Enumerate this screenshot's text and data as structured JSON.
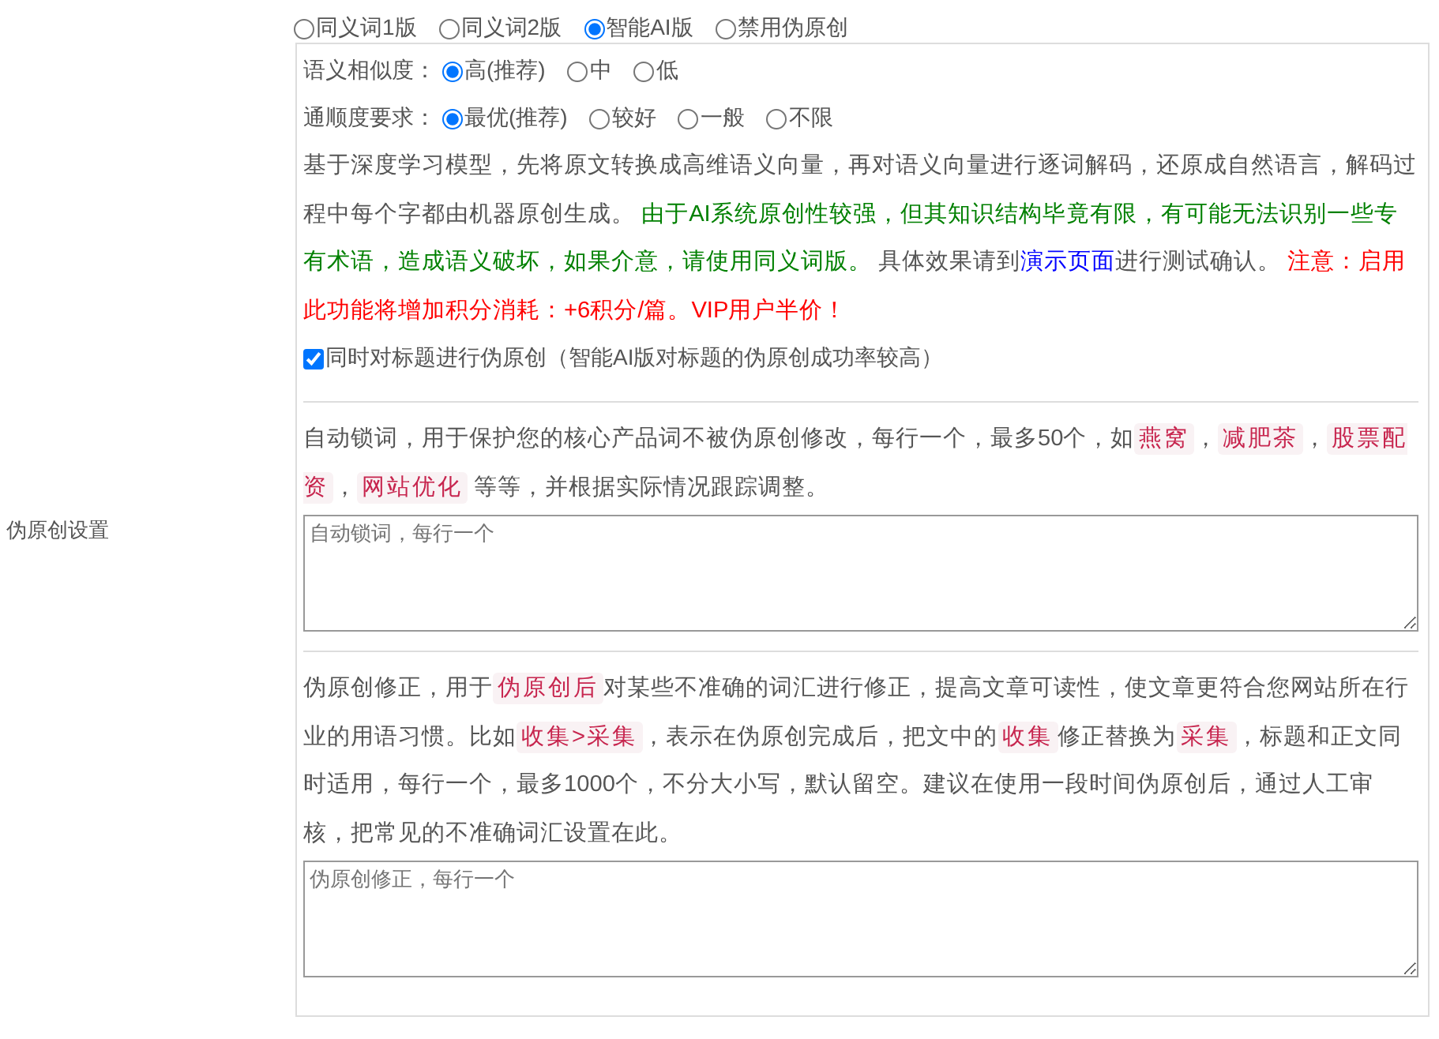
{
  "section_label": "伪原创设置",
  "modes": [
    {
      "label": "同义词1版",
      "selected": false
    },
    {
      "label": "同义词2版",
      "selected": false
    },
    {
      "label": "智能AI版",
      "selected": true
    },
    {
      "label": "禁用伪原创",
      "selected": false
    }
  ],
  "settings": [
    {
      "label": "语义相似度：",
      "options": [
        {
          "label": "高(推荐)",
          "selected": true
        },
        {
          "label": "中",
          "selected": false
        },
        {
          "label": "低",
          "selected": false
        }
      ]
    },
    {
      "label": "通顺度要求：",
      "options": [
        {
          "label": "最优(推荐)",
          "selected": true
        },
        {
          "label": "较好",
          "selected": false
        },
        {
          "label": "一般",
          "selected": false
        },
        {
          "label": "不限",
          "selected": false
        }
      ]
    }
  ],
  "description": [
    {
      "kind": "text",
      "text": "基于深度学习模型，先将原文转换成高维语义向量，再对语义向量进行逐词解码，还原成自然语言，解码过程中每个字都由机器原创生成。 "
    },
    {
      "kind": "green",
      "text": "由于AI系统原创性较强，但其知识结构毕竟有限，有可能无法识别一些专有术语，造成语义破坏，如果介意，请使用同义词版。"
    },
    {
      "kind": "text",
      "text": " 具体效果请到"
    },
    {
      "kind": "link",
      "text": "演示页面"
    },
    {
      "kind": "text",
      "text": "进行测试确认。 "
    },
    {
      "kind": "red",
      "text": "注意：启用此功能将增加积分消耗：+6积分/篇。VIP用户半价！"
    }
  ],
  "title_option": {
    "label": "同时对标题进行伪原创（智能AI版对标题的伪原创成功率较高）",
    "checked": true
  },
  "lock_words": {
    "description": [
      {
        "kind": "text",
        "text": "自动锁词，用于保护您的核心产品词不被伪原创修改，每行一个，最多50个，如"
      },
      {
        "kind": "code",
        "text": "燕窝"
      },
      {
        "kind": "text",
        "text": "，"
      },
      {
        "kind": "code",
        "text": "减肥茶"
      },
      {
        "kind": "text",
        "text": "，"
      },
      {
        "kind": "code",
        "text": "股票配资"
      },
      {
        "kind": "text",
        "text": "，"
      },
      {
        "kind": "code",
        "text": "网站优化"
      },
      {
        "kind": "text",
        "text": " 等等，并根据实际情况跟踪调整。"
      }
    ],
    "placeholder": "自动锁词，每行一个"
  },
  "correction": {
    "description": [
      {
        "kind": "text",
        "text": "伪原创修正，用于"
      },
      {
        "kind": "code",
        "text": "伪原创后"
      },
      {
        "kind": "text",
        "text": "对某些不准确的词汇进行修正，提高文章可读性，使文章更符合您网站所在行业的用语习惯。比如"
      },
      {
        "kind": "code",
        "text": "收集>采集"
      },
      {
        "kind": "text",
        "text": "，表示在伪原创完成后，把文中的"
      },
      {
        "kind": "code",
        "text": "收集"
      },
      {
        "kind": "text",
        "text": "修正替换为"
      },
      {
        "kind": "code",
        "text": "采集"
      },
      {
        "kind": "text",
        "text": "，标题和正文同时适用，每行一个，最多1000个，不分大小写，默认留空。建议在使用一段时间伪原创后，通过人工审核，把常见的不准确词汇设置在此。"
      }
    ],
    "placeholder": "伪原创修正，每行一个"
  }
}
